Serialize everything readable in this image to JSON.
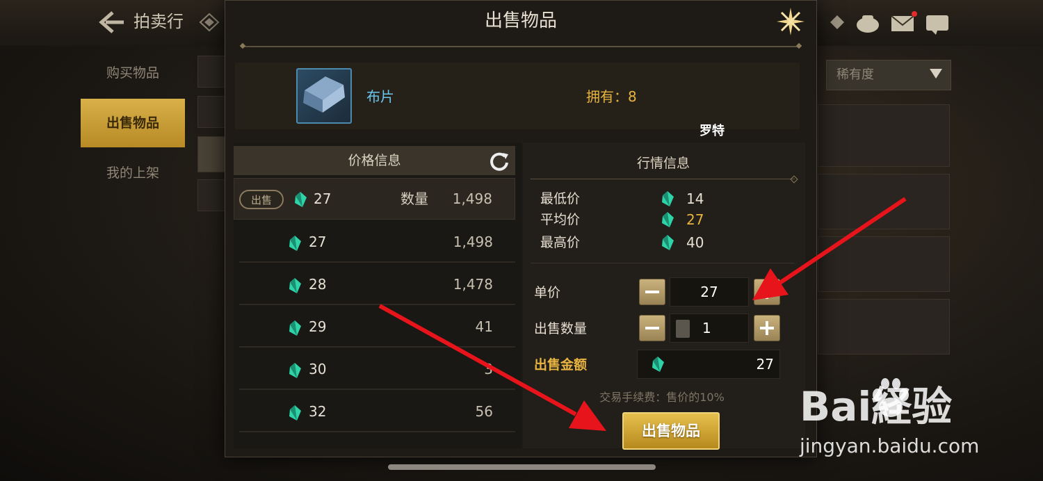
{
  "app": {
    "title": "拍卖行"
  },
  "sidebar": {
    "items": [
      {
        "label": "购买物品"
      },
      {
        "label": "出售物品"
      },
      {
        "label": "我的上架"
      }
    ]
  },
  "sort": {
    "selected": "稀有度"
  },
  "modal": {
    "title": "出售物品",
    "item": {
      "name": "布片",
      "own_label": "拥有：",
      "own_value": "8",
      "server": "罗特"
    },
    "price_info": {
      "header": "价格信息",
      "sell_tag": "出售",
      "qty_label": "数量",
      "rows": [
        {
          "price": "27",
          "qty": "1,498"
        },
        {
          "price": "27",
          "qty": "1,498"
        },
        {
          "price": "28",
          "qty": "1,478"
        },
        {
          "price": "29",
          "qty": "41"
        },
        {
          "price": "30",
          "qty": "3"
        },
        {
          "price": "32",
          "qty": "56"
        }
      ]
    },
    "market_info": {
      "header": "行情信息",
      "min_label": "最低价",
      "min_value": "14",
      "avg_label": "平均价",
      "avg_value": "27",
      "max_label": "最高价",
      "max_value": "40"
    },
    "form": {
      "unit_price_label": "单价",
      "unit_price": "27",
      "quantity_label": "出售数量",
      "quantity": "1",
      "total_label": "出售金额",
      "total": "27",
      "fee_text": "交易手续费：售价的10%",
      "submit_label": "出售物品"
    }
  },
  "watermark": {
    "brand": "Bai経验",
    "url": "jingyan.baidu.com"
  },
  "colors": {
    "gold": "#e8b441",
    "accent_blue": "#6cc7ef",
    "gem_teal": "#2fd3a8",
    "arrow_red": "#e8141b"
  }
}
